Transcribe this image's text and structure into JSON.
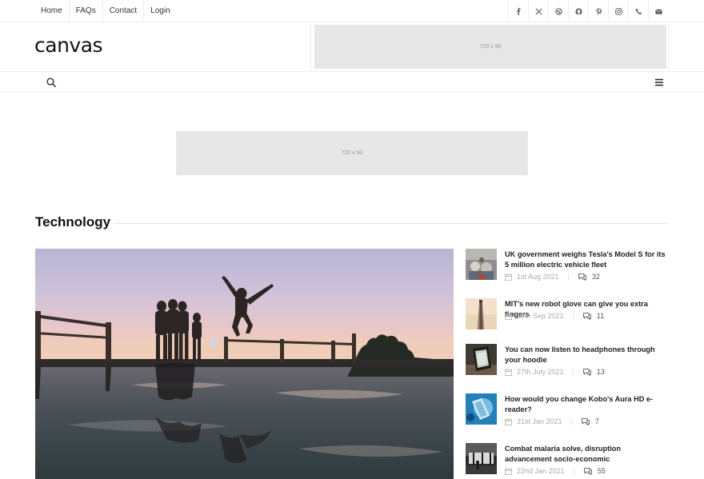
{
  "topnav": {
    "items": [
      "Home",
      "FAQs",
      "Contact",
      "Login"
    ]
  },
  "social": [
    "facebook-icon",
    "x-icon",
    "dribbble-icon",
    "github-icon",
    "pinterest-icon",
    "instagram-icon",
    "phone-icon",
    "email-icon"
  ],
  "header": {
    "logo": "canvas",
    "ad_label": "720 x 90"
  },
  "ad_center": {
    "label": "720 x 90"
  },
  "section": {
    "title": "Technology"
  },
  "articles": [
    {
      "title": "UK government weighs Tesla's Model S for its 5 million electric vehicle fleet",
      "date": "1st Aug 2021",
      "comments": "32"
    },
    {
      "title": "MIT's new robot glove can give you extra fingers",
      "date": "13th Sep 2021",
      "comments": "11"
    },
    {
      "title": "You can now listen to headphones through your hoodie",
      "date": "27th July 2021",
      "comments": "13"
    },
    {
      "title": "How would you change Kobo's Aura HD e-reader?",
      "date": "31st Jan 2021",
      "comments": "7"
    },
    {
      "title": "Combat malaria solve, disruption advancement socio-economic",
      "date": "22nd Jan 2021",
      "comments": "55"
    }
  ]
}
